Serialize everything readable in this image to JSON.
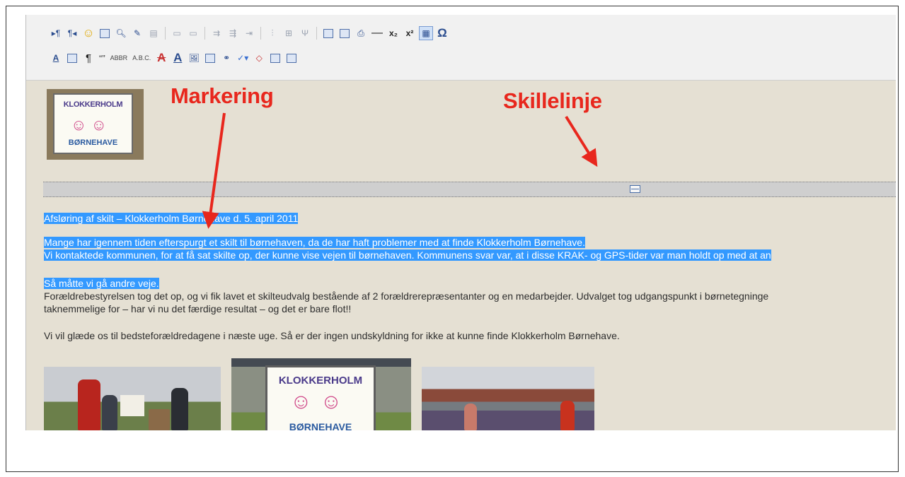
{
  "toolbar": {
    "row1": [
      "ltr-icon",
      "rtl-icon",
      "smiley-icon",
      "flash-icon",
      "preview-icon",
      "edit-icon",
      "template-icon",
      "table-icon",
      "table-props-icon",
      "row-insert-icon",
      "col-insert-icon",
      "cell-merge-icon",
      "split-icon",
      "col-width-icon",
      "delete-col-icon",
      "grid-icon",
      "grid2-icon",
      "print-icon",
      "horizontal-rule-icon",
      "subscript-icon",
      "superscript-icon",
      "visual-aid-icon",
      "special-char-icon"
    ],
    "row2": [
      "style-icon",
      "help-icon",
      "paragraph-mark-icon",
      "quote-icon",
      "abbr-icon",
      "acronym-icon",
      "text-color-icon",
      "bg-color-icon",
      "image-icon",
      "media-icon",
      "link-icon",
      "spellcheck-icon",
      "code-icon",
      "layer-icon",
      "columns-icon"
    ],
    "labels": {
      "quote": "“”",
      "abbr": "ABBR",
      "acronym": "A.B.C.",
      "omega": "Ω",
      "sub": "x₂",
      "sup": "x²",
      "pilcrow": "¶"
    }
  },
  "logo": {
    "line1": "KLOKKERHOLM",
    "line2": "BØRNEHAVE"
  },
  "content": {
    "heading": "Afsløring af skilt – Klokkerholm Børnehave d. 5. april 2011",
    "p1_line1": "Mange har igennem tiden efterspurgt et skilt til børnehaven, da de har haft problemer med at finde Klokkerholm Børnehave.",
    "p1_line2": "Vi kontaktede kommunen, for at få sat skilte op, der kunne vise vejen til børnehaven. Kommunens svar var, at i disse KRAK- og GPS-tider var man holdt op med at an",
    "p2_line1": "Så måtte vi gå andre veje.",
    "p2_line2": "Forældrebestyrelsen tog det op, og vi fik lavet et skilteudvalg bestående af  2 forældrerepræsentanter og en medarbejder. Udvalget tog udgangspunkt i børnetegninge",
    "p2_line3": "taknemmelige for – har vi nu det færdige resultat – og det er bare flot!!",
    "p3": "Vi vil glæde os til bedsteforældredagene i næste uge. Så er der ingen undskyldning for ikke at kunne finde Klokkerholm Børnehave."
  },
  "annotations": {
    "markering": "Markering",
    "skillelinje": "Skillelinje"
  },
  "colors": {
    "selection": "#3399ff",
    "annotation": "#e8271d",
    "content_bg": "#e5e0d3"
  }
}
